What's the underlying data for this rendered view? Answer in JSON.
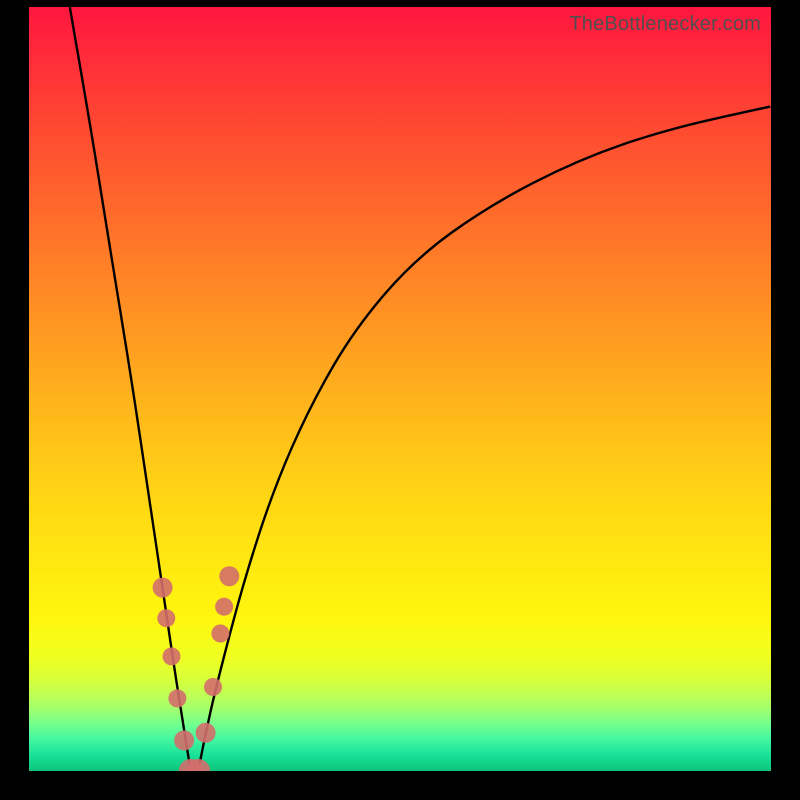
{
  "watermark": "TheBottlenecker.com",
  "colors": {
    "curve": "#000000",
    "marker": "#d36e6c",
    "frame": "#000000"
  },
  "chart_data": {
    "type": "line",
    "title": "",
    "xlabel": "",
    "ylabel": "",
    "xlim": [
      0,
      1
    ],
    "ylim": [
      0,
      1
    ],
    "note": "Axes are unlabeled in the source image; x and y are normalized plot-area coordinates (0..1). The curve is a V-shaped dip reaching ~0 near x≈0.22, with the right branch rising asymptotically toward ~0.87.",
    "series": [
      {
        "name": "left-branch",
        "x": [
          0.055,
          0.08,
          0.1,
          0.12,
          0.14,
          0.16,
          0.18,
          0.195,
          0.208,
          0.218
        ],
        "values": [
          1.0,
          0.86,
          0.74,
          0.62,
          0.5,
          0.37,
          0.24,
          0.14,
          0.06,
          0.0
        ]
      },
      {
        "name": "right-branch",
        "x": [
          0.228,
          0.24,
          0.26,
          0.29,
          0.33,
          0.38,
          0.44,
          0.52,
          0.62,
          0.74,
          0.86,
          1.0
        ],
        "values": [
          0.0,
          0.06,
          0.14,
          0.25,
          0.37,
          0.48,
          0.58,
          0.67,
          0.74,
          0.8,
          0.84,
          0.87
        ]
      }
    ],
    "markers": {
      "name": "highlighted-points",
      "x": [
        0.18,
        0.185,
        0.192,
        0.2,
        0.209,
        0.218,
        0.228,
        0.238,
        0.248,
        0.258,
        0.263,
        0.27
      ],
      "y": [
        0.24,
        0.2,
        0.15,
        0.095,
        0.04,
        0.0,
        0.0,
        0.05,
        0.11,
        0.18,
        0.215,
        0.255
      ],
      "r": [
        10,
        9,
        9,
        9,
        10,
        12,
        12,
        10,
        9,
        9,
        9,
        10
      ]
    }
  }
}
